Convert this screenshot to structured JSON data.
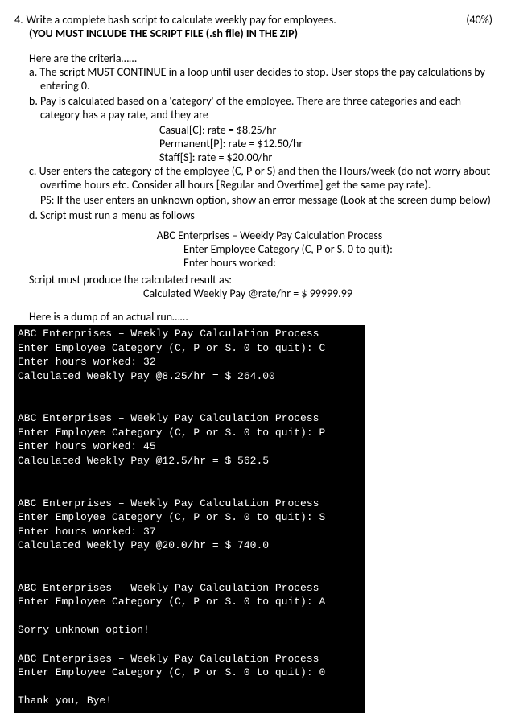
{
  "question": {
    "number": "4.",
    "title": "Write a complete bash script to calculate weekly pay for employees.",
    "percentage": "(40%)",
    "note": "(YOU MUST INCLUDE THE SCRIPT FILE (.sh file) IN THE ZIP)"
  },
  "criteria_intro": "Here are the criteria……",
  "criteria": {
    "a": "a. The script MUST CONTINUE in a loop until user decides to stop. User stops the pay calculations by entering 0.",
    "b": "b. Pay is calculated based on a 'category' of the employee. There are three categories and each category has a pay rate, and they are",
    "rates": {
      "casual": "Casual[C]:  rate = $8.25/hr",
      "permanent": "Permanent[P]: rate = $12.50/hr",
      "staff": "Staff[S]: rate = $20.00/hr"
    },
    "c": "c. User enters the category of the employee (C, P or S) and then the Hours/week (do not worry about overtime hours etc. Consider all hours [Regular and Overtime] get the same pay rate).",
    "c_ps": "PS: If the user enters an unknown option, show an error message (Look at the screen dump below)",
    "d": "d. Script must run a menu as follows"
  },
  "menu": {
    "title": "ABC Enterprises – Weekly Pay Calculation Process",
    "line1": "Enter Employee Category (C, P or S. 0 to quit):",
    "line2": "Enter hours worked:"
  },
  "result_intro": "Script must produce the calculated result as:",
  "result_line": "Calculated Weekly Pay @rate/hr = $ 99999.99",
  "dump_intro": "Here is a dump of an actual run……",
  "terminal_lines": [
    "ABC Enterprises – Weekly Pay Calculation Process",
    "Enter Employee Category (C, P or S. 0 to quit): C",
    "Enter hours worked: 32",
    "Calculated Weekly Pay @8.25/hr = $ 264.00",
    "",
    "",
    "ABC Enterprises – Weekly Pay Calculation Process",
    "Enter Employee Category (C, P or S. 0 to quit): P",
    "Enter hours worked: 45",
    "Calculated Weekly Pay @12.5/hr = $ 562.5",
    "",
    "",
    "ABC Enterprises – Weekly Pay Calculation Process",
    "Enter Employee Category (C, P or S. 0 to quit): S",
    "Enter hours worked: 37",
    "Calculated Weekly Pay @20.0/hr = $ 740.0",
    "",
    "",
    "ABC Enterprises – Weekly Pay Calculation Process",
    "Enter Employee Category (C, P or S. 0 to quit): A",
    "",
    "Sorry unknown option!",
    "",
    "ABC Enterprises – Weekly Pay Calculation Process",
    "Enter Employee Category (C, P or S. 0 to quit): 0",
    "",
    "Thank you, Bye!"
  ]
}
